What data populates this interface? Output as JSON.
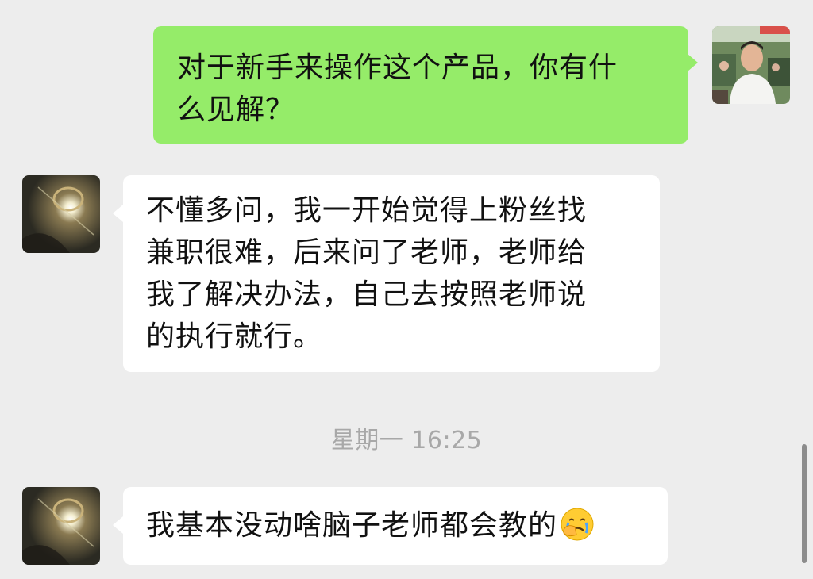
{
  "messages": [
    {
      "side": "outgoing",
      "lines": [
        "对于新手来操作这个产品，你有什",
        "么见解？"
      ]
    },
    {
      "side": "incoming",
      "lines": [
        "不懂多问，我一开始觉得上粉丝找",
        "兼职很难，后来问了老师，老师给",
        "我了解决办法，自己去按照老师说",
        "的执行就行。"
      ]
    },
    {
      "side": "incoming",
      "text": "我基本没动啥脑子老师都会教的",
      "emoji": "face-palm-crying-emoji"
    }
  ],
  "timestamp": "星期一 16:25",
  "colors": {
    "background": "#ededed",
    "outgoing_bubble": "#95ec69",
    "incoming_bubble": "#ffffff",
    "timestamp_text": "#a8a8a8"
  }
}
